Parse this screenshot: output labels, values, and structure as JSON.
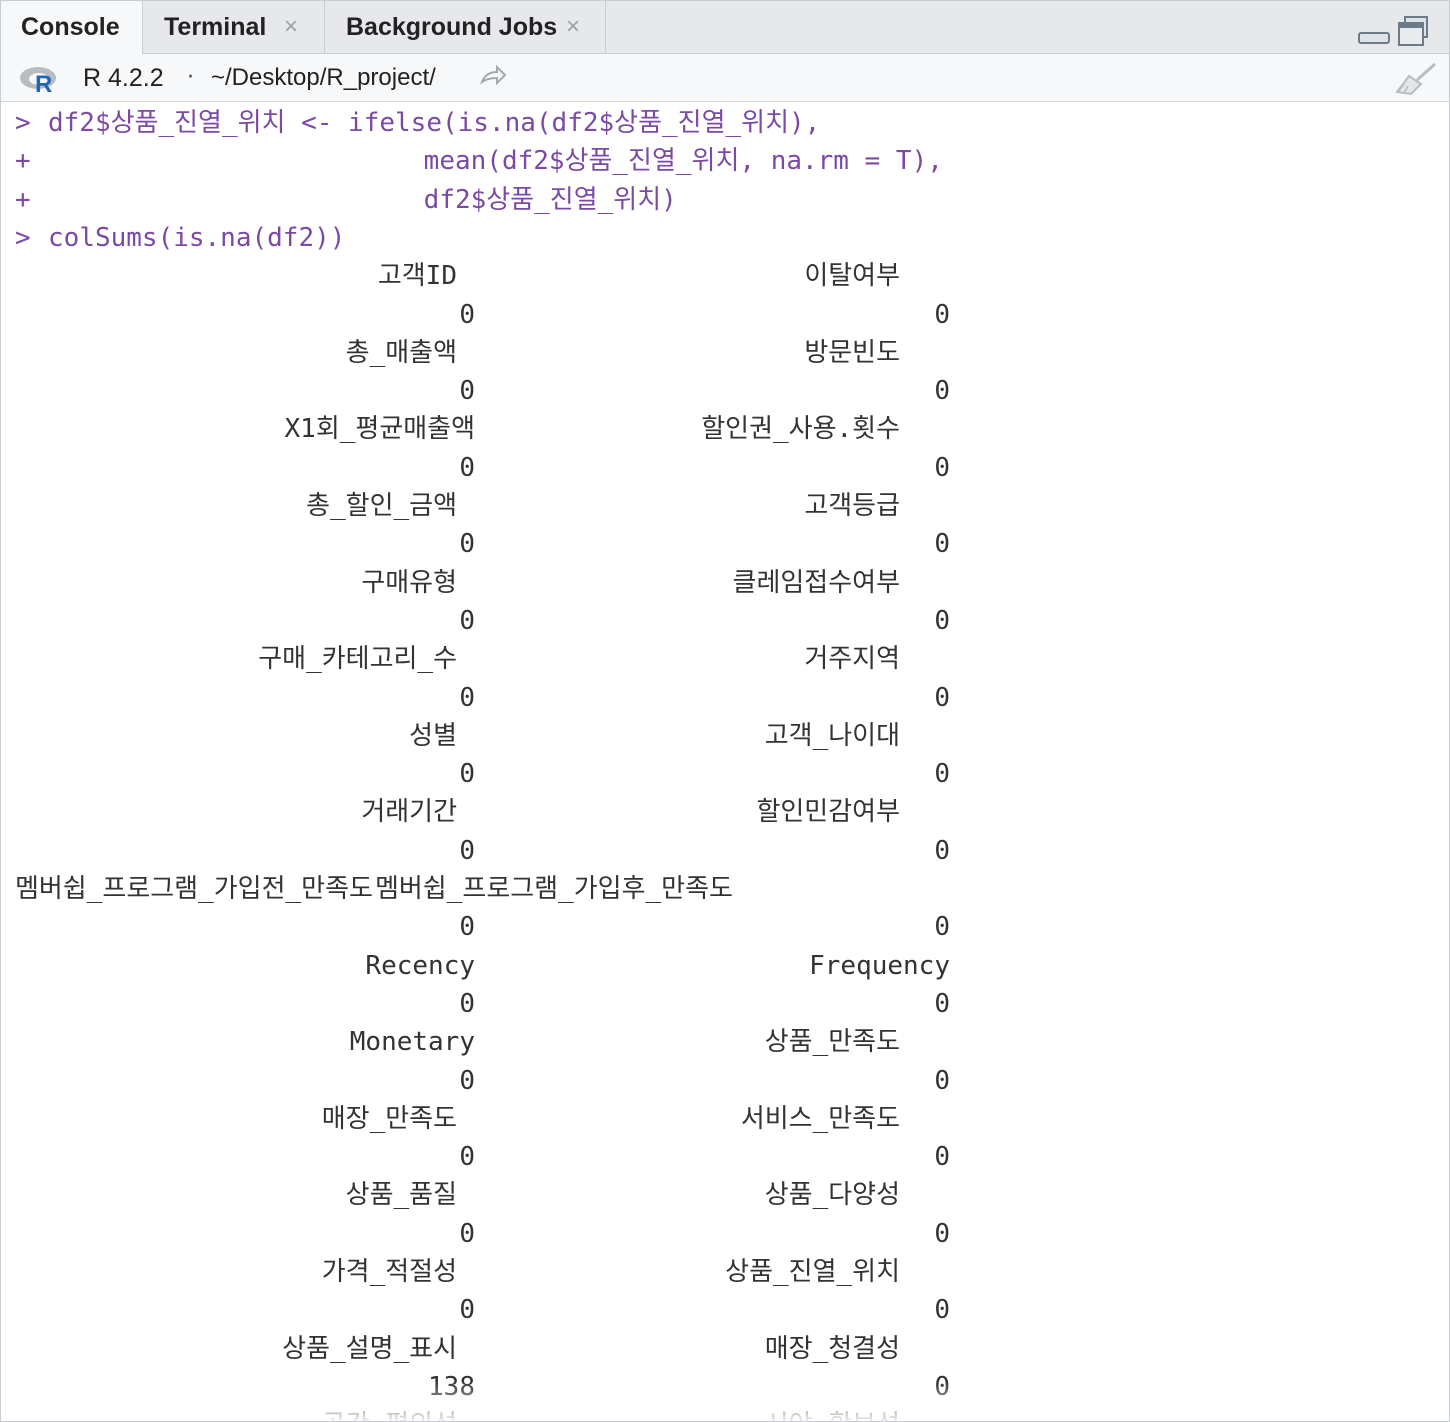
{
  "tabs": [
    {
      "label": "Console",
      "active": true,
      "closable": false
    },
    {
      "label": "Terminal",
      "active": false,
      "closable": true
    },
    {
      "label": "Background Jobs",
      "active": false,
      "closable": true
    }
  ],
  "toolbar": {
    "r_version": "R 4.2.2",
    "separator": "·",
    "working_dir": "~/Desktop/R_project/",
    "icons": [
      "r-logo-icon",
      "goto-directory-icon",
      "clear-console-broom-icon",
      "minimize-icon",
      "maximize-icon"
    ]
  },
  "console": {
    "commands": [
      {
        "prompt": ">",
        "text": "df2$상품_진열_위치 <- ifelse(is.na(df2$상품_진열_위치),"
      },
      {
        "prompt": "+",
        "text": "                        mean(df2$상품_진열_위치, na.rm = T),"
      },
      {
        "prompt": "+",
        "text": "                        df2$상품_진열_위치)"
      },
      {
        "prompt": ">",
        "text": "colSums(is.na(df2))"
      }
    ],
    "output_rows": [
      {
        "left_name": "고객ID",
        "left_value": "0",
        "right_name": "이탈여부",
        "right_value": "0"
      },
      {
        "left_name": "총_매출액",
        "left_value": "0",
        "right_name": "방문빈도",
        "right_value": "0"
      },
      {
        "left_name": "X1회_평균매출액",
        "left_value": "0",
        "right_name": "할인권_사용.횟수",
        "right_value": "0"
      },
      {
        "left_name": "총_할인_금액",
        "left_value": "0",
        "right_name": "고객등급",
        "right_value": "0"
      },
      {
        "left_name": "구매유형",
        "left_value": "0",
        "right_name": "클레임접수여부",
        "right_value": "0"
      },
      {
        "left_name": "구매_카테고리_수",
        "left_value": "0",
        "right_name": "거주지역",
        "right_value": "0"
      },
      {
        "left_name": "성별",
        "left_value": "0",
        "right_name": "고객_나이대",
        "right_value": "0"
      },
      {
        "left_name": "거래기간",
        "left_value": "0",
        "right_name": "할인민감여부",
        "right_value": "0"
      },
      {
        "left_name": "멤버쉽_프로그램_가입전_만족도",
        "left_value": "0",
        "right_name": "멤버쉽_프로그램_가입후_만족도",
        "right_value": "0"
      },
      {
        "left_name": "Recency",
        "left_value": "0",
        "right_name": "Frequency",
        "right_value": "0"
      },
      {
        "left_name": "Monetary",
        "left_value": "0",
        "right_name": "상품_만족도",
        "right_value": "0"
      },
      {
        "left_name": "매장_만족도",
        "left_value": "0",
        "right_name": "서비스_만족도",
        "right_value": "0"
      },
      {
        "left_name": "상품_품질",
        "left_value": "0",
        "right_name": "상품_다양성",
        "right_value": "0"
      },
      {
        "left_name": "가격_적절성",
        "left_value": "0",
        "right_name": "상품_진열_위치",
        "right_value": "0"
      },
      {
        "left_name": "상품_설명_표시",
        "left_value": "138",
        "right_name": "매장_청결성",
        "right_value": "0"
      },
      {
        "left_name": "공간_편의성",
        "left_value": "",
        "right_name": "시야_확보성",
        "right_value": ""
      }
    ]
  },
  "colors": {
    "command": "#7b4aa5",
    "output": "#333333",
    "tab_bar": "#e6e8eb"
  }
}
